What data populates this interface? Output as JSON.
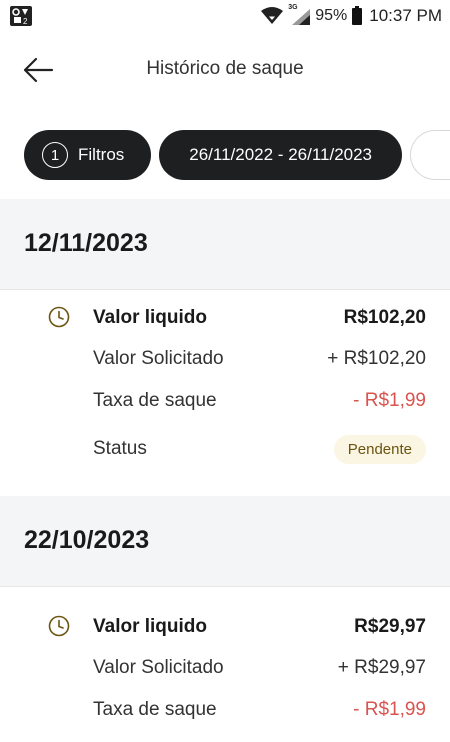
{
  "status_bar": {
    "network": "3G",
    "battery": "95%",
    "time": "10:37 PM"
  },
  "header": {
    "title": "Histórico de saque",
    "back_icon": "arrow-left-icon"
  },
  "filters": {
    "count": "1",
    "label": "Filtros",
    "date_range": "26/11/2022 - 26/11/2023"
  },
  "colors": {
    "chip_bg": "#1d1f20",
    "section_bg": "#f4f5f7",
    "negative": "#d9534f",
    "badge_bg": "#fbf5e3",
    "badge_text": "#6b5410",
    "clock": "#6b5410"
  },
  "sections": [
    {
      "date": "12/11/2023",
      "transaction": {
        "icon": "clock-icon",
        "net_label": "Valor liquido",
        "net_value": "R$102,20",
        "requested_label": "Valor Solicitado",
        "requested_value": "+ R$102,20",
        "fee_label": "Taxa de saque",
        "fee_value": "- R$1,99",
        "status_label": "Status",
        "status_value": "Pendente"
      }
    },
    {
      "date": "22/10/2023",
      "transaction": {
        "icon": "clock-icon",
        "net_label": "Valor liquido",
        "net_value": "R$29,97",
        "requested_label": "Valor Solicitado",
        "requested_value": "+ R$29,97",
        "fee_label": "Taxa de saque",
        "fee_value": "- R$1,99"
      }
    }
  ]
}
